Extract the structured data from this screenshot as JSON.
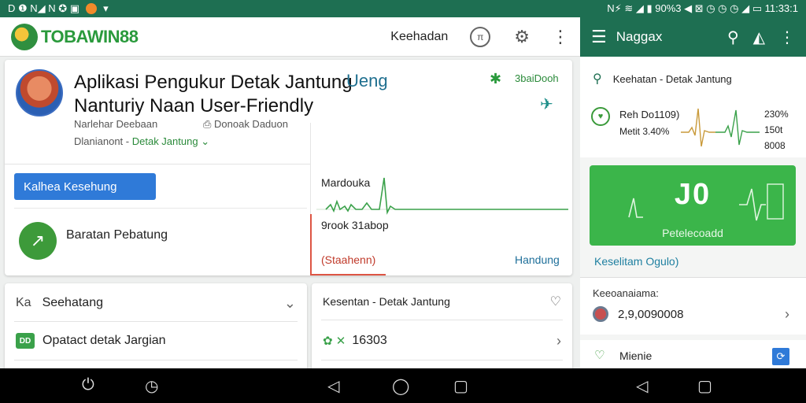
{
  "status_bar": {
    "left_text": "D ❶ N◢ N ✪ ▣",
    "right_text": "N⚡ ≋ ◢ ▮ 90%3  ◀ ⊠ ◷  ◷ ◷ ◢ ▭ 11:33:1"
  },
  "app_bar": {
    "logo_text": "TOBAWIN88",
    "nav_link": "Keehadan",
    "round_button_label": "π",
    "colors": {
      "brand": "#2a9a3c",
      "header": "#1e6f52"
    }
  },
  "app_card": {
    "title": "Aplikasi Pengukur Detak Jantung Nanturiy Naan User-Friendly",
    "title_accent": "Ueng",
    "developer": "Narlehar Deebaan",
    "downloads_meta": "Donoak Daduon",
    "category_label": "Dlanianont -",
    "category_link": "Detak Jantung",
    "download_count": "3baiDooh",
    "primary_button": "Kalhea Kesehung",
    "feature_label": "Baratan Pebatung"
  },
  "chart": {
    "title": "Mardouka",
    "value_label": "9rook 31abop",
    "status": "(Staahenn)",
    "link": "Handung"
  },
  "list_left": {
    "header_icon_text": "Ka",
    "header_label": "Seehatang",
    "row_badge": "DD",
    "row_label": "Opatact detak Jargian"
  },
  "list_right": {
    "header_label": "Kesentan - Detak Jantung",
    "row_label": "16303"
  },
  "right_header": {
    "title": "Naggax"
  },
  "right_panel": {
    "search_label": "Keehatan - Detak Jantung",
    "heartbeat_line1": "Reh Do1109)",
    "heartbeat_line2": "Metit 3.40%",
    "stat1": "230%",
    "stat2": "150t",
    "stat3": "8008",
    "big_value": "J0",
    "big_label": "Petelecoadd",
    "link": "Keselitam Ogulo)",
    "sub_label": "Keeoanaiama:",
    "value": "2,9,0090008",
    "menu_label": "Mienie"
  }
}
